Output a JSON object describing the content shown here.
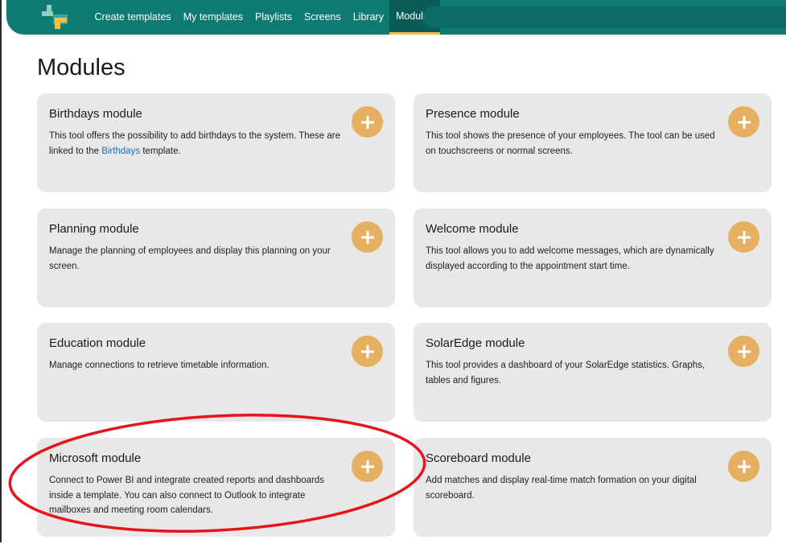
{
  "nav": {
    "items": [
      {
        "label": "Create templates",
        "active": false
      },
      {
        "label": "My templates",
        "active": false
      },
      {
        "label": "Playlists",
        "active": false
      },
      {
        "label": "Screens",
        "active": false
      },
      {
        "label": "Library",
        "active": false
      },
      {
        "label": "Modules",
        "active": true
      }
    ]
  },
  "page": {
    "title": "Modules"
  },
  "modules": [
    {
      "title": "Birthdays module",
      "desc_before": "This tool offers the possibility to add birthdays to the system. These are linked to the ",
      "link": "Birthdays",
      "desc_after": " template."
    },
    {
      "title": "Presence module",
      "description": "This tool shows the presence of your employees. The tool can be used on touchscreens or normal screens."
    },
    {
      "title": "Planning module",
      "description": "Manage the planning of employees and display this planning on your screen."
    },
    {
      "title": "Welcome module",
      "description": "This tool allows you to add welcome messages, which are dynamically displayed according to the appointment start time."
    },
    {
      "title": "Education module",
      "description": "Manage connections to retrieve timetable information."
    },
    {
      "title": "SolarEdge module",
      "description": "This tool provides a dashboard of your SolarEdge statistics. Graphs, tables and figures."
    },
    {
      "title": "Microsoft module",
      "description": "Connect to  Power  BI and integrate created reports and dashboards inside a template. You can also connect to Outlook to integrate mailboxes and meeting room calendars."
    },
    {
      "title": "Scoreboard module",
      "description": "Add matches and display real-time match formation on your digital scoreboard."
    }
  ],
  "icons": {
    "add": "plus-icon",
    "logo": "app-logo"
  },
  "colors": {
    "nav_bg": "#0e7a72",
    "nav_active": "#0b5c56",
    "active_underline": "#f0c24a",
    "card_bg": "#e8e8e8",
    "add_button": "#e6b062",
    "link": "#1670c9",
    "annotation_circle": "#e8141b"
  }
}
